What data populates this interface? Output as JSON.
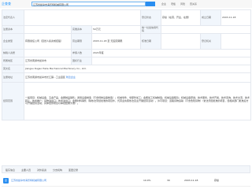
{
  "header": {
    "logo_text": "企查查",
    "search_text": "江苏省如皋市海乐特机械有限公司",
    "search_button_label": "",
    "links": [
      "企业",
      "老板",
      "风险",
      "查关系"
    ]
  },
  "table": {
    "legal_rep_label": "法定代表人",
    "legal_rep_value": "",
    "reg_status_label": "登记状态",
    "reg_status_value": "存续（在营、开业、在册）",
    "established_label": "成立日期",
    "established_value": "2003-11-18",
    "reg_capital_label": "注册资本",
    "reg_capital_value": "",
    "paid_capital_label": "实缴资本",
    "paid_capital_value": "50万元",
    "credit_code_label": "统一社会信用代码",
    "credit_code_value": "",
    "company_type_label": "企业类型",
    "company_type_value": "有限责任公司（自然人投资或控股）",
    "business_term_label": "营业期限",
    "business_term_value": "2003-11-18 至 无固定期限",
    "approval_date_label": "核准日期",
    "approval_date_value": "",
    "authority_label": "登记机关",
    "authority_value": "",
    "taxpayer_label": "纳税人资质",
    "taxpayer_value": "",
    "insured_label": "参保人数",
    "insured_value": "2021年度",
    "region_label": "所属地区",
    "region_value": "江苏省南通市如皋市",
    "industry_label": "国标行业",
    "industry_value": "",
    "english_name_label": "英文名",
    "english_name_value": "Jiangsu Rugao Haile Mechanical Machinery Co., Ltd.",
    "address_label": "注册地址",
    "address_value": "江苏省南通市如皋市长江镇...工业园区",
    "address_link": "附近企业",
    "scope_label": "经营范围",
    "scope_value": "一般项目：机械设备、五金产品、金属制品销售；通用设备制造（不含特种设备制造）；机械零件、零部件加工；金属加工机械制造；机械设备租赁；机械设备研发；技术服务、技术开发、技术咨询、技术交流、技术转让、技术推广；货物进出口；技术进出口；金属材料销售（除依法须经批准的项目外，凭营业执照依法自主开展经营活动）。许可项目：道路货物运输（不含危险货物）（依法须经批准的项目，经相关部门批准后方可开展经营活动，具体经营项目以审批结果为准）。"
  },
  "bottom_tabs": [
    "股东信息",
    "主要人员",
    "对外投资",
    "分支机构",
    "变更记录"
  ],
  "bottom_row": {
    "icon_text": "企",
    "name": "江苏省如皋市海乐特机械有限公司",
    "values": [
      "10.0%",
      "30",
      "2003-11-18",
      "存续"
    ]
  }
}
